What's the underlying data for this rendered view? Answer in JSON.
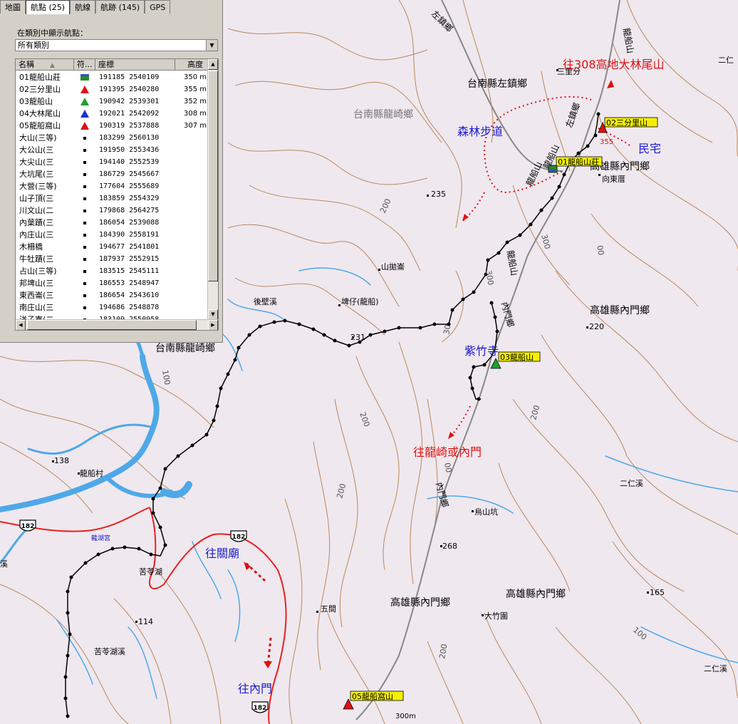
{
  "panel": {
    "tabs": [
      {
        "label": "地圖",
        "active": false
      },
      {
        "label": "航點 (25)",
        "active": true
      },
      {
        "label": "航線",
        "active": false
      },
      {
        "label": "航跡 (145)",
        "active": false
      },
      {
        "label": "GPS",
        "active": false
      }
    ],
    "category_label": "在類別中顯示航點：",
    "category_value": "所有類別",
    "columns": {
      "name": "名稱",
      "symbol": "符...",
      "coords": "座標",
      "altitude": "高度"
    },
    "waypoints": [
      {
        "name": "01龍船山莊",
        "symbol": "house-icon",
        "coords": "191185 2540109",
        "alt": "350 m"
      },
      {
        "name": "02三分里山",
        "symbol": "red-summit-icon",
        "coords": "191395 2540280",
        "alt": "355 m"
      },
      {
        "name": "03龍船山",
        "symbol": "green-summit-icon",
        "coords": "190942 2539301",
        "alt": "352 m"
      },
      {
        "name": "04大林尾山",
        "symbol": "blue-summit-icon",
        "coords": "192021 2542092",
        "alt": "308 m"
      },
      {
        "name": "05龍船窩山",
        "symbol": "red-summit-icon",
        "coords": "190319 2537888",
        "alt": "307 m"
      },
      {
        "name": "大山(三等)",
        "symbol": "dot-icon",
        "coords": "183299 2560130",
        "alt": ""
      },
      {
        "name": "大公山(三",
        "symbol": "dot-icon",
        "coords": "191950 2553436",
        "alt": ""
      },
      {
        "name": "大尖山(三",
        "symbol": "dot-icon",
        "coords": "194140 2552539",
        "alt": ""
      },
      {
        "name": "大坑尾(三",
        "symbol": "dot-icon",
        "coords": "186729 2545667",
        "alt": ""
      },
      {
        "name": "大營(三等)",
        "symbol": "dot-icon",
        "coords": "177604 2555689",
        "alt": ""
      },
      {
        "name": "山子頂(三",
        "symbol": "dot-icon",
        "coords": "183859 2554329",
        "alt": ""
      },
      {
        "name": "川文山(二",
        "symbol": "dot-icon",
        "coords": "179868 2564275",
        "alt": ""
      },
      {
        "name": "內葉蹟(三",
        "symbol": "dot-icon",
        "coords": "186054 2539088",
        "alt": ""
      },
      {
        "name": "內庄山(三",
        "symbol": "dot-icon",
        "coords": "184390 2558191",
        "alt": ""
      },
      {
        "name": "木柵橋",
        "symbol": "dot-icon",
        "coords": "194677 2541801",
        "alt": ""
      },
      {
        "name": "牛牡蹟(三",
        "symbol": "dot-icon",
        "coords": "187937 2552915",
        "alt": ""
      },
      {
        "name": "占山(三等)",
        "symbol": "dot-icon",
        "coords": "183515 2545111",
        "alt": ""
      },
      {
        "name": "邦埤山(三",
        "symbol": "dot-icon",
        "coords": "186553 2548947",
        "alt": ""
      },
      {
        "name": "東西崙(三",
        "symbol": "dot-icon",
        "coords": "186654 2543610",
        "alt": ""
      },
      {
        "name": "南庄山(三",
        "symbol": "dot-icon",
        "coords": "194686 2548878",
        "alt": ""
      },
      {
        "name": "洋子寮(二",
        "symbol": "dot-icon",
        "coords": "183109 2550958",
        "alt": ""
      }
    ]
  },
  "map": {
    "towns": {
      "zuozhen": "台南縣左鎮鄉",
      "longqi_top": "台南縣龍崎鄉",
      "longqi": "台南縣龍崎鄉",
      "neimen_a": "高雄縣內門鄉",
      "neimen_b": "高雄縣內門鄉",
      "neimen_c": "高雄縣內門鄉",
      "neimen_d": "高雄縣內門鄉"
    },
    "places": {
      "sanlifen": "三里分",
      "xiangdongcuo": "向東厝",
      "shanpaolun": "山拋崙",
      "pizai": "埤仔(龍船)",
      "houbixi": "後壁溪",
      "longchuancun": "龍船村",
      "kuchahu": "苦苓湖",
      "kuchahuxi": "苦苓湖溪",
      "wujian": "五間",
      "wushankeng": "烏山坑",
      "dazhuwei": "大竹圍",
      "errenxi_a": "二仁溪",
      "errenxi_b": "二仁溪",
      "errenxi_c": "二仁",
      "xi_left": "溪",
      "hulonggong": "龍湖宮"
    },
    "roads": {
      "zuozhen_road": "左鎮鄉",
      "zuozhen_road2": "左鎮鄉",
      "longchuan_road": "龍船山",
      "longchuan_road2": "龍船山",
      "longchuan_road3": "龍船山",
      "longchuan_road4": "龍船山",
      "neimen_road": "內門鄉",
      "neimen_road2": "內門鄉",
      "route_182": "182"
    },
    "elevations": {
      "e235": "235",
      "e231": "231",
      "e200a": "200",
      "e200b": "200",
      "e200c": "200",
      "e200d": "200",
      "e200e": "200",
      "e300": "300",
      "e300b": "300",
      "e100a": "100",
      "e100b": "100",
      "e138": "138",
      "e114": "114",
      "e220": "220",
      "e268": "268",
      "e165": "165",
      "e355": "355",
      "e300m": "300m",
      "e30": "30",
      "e00": "00"
    },
    "waypoint_labels": {
      "wp01": "01龍船山莊",
      "wp02": "02三分里山",
      "wp03": "03龍船山",
      "wp05": "05龍船窩山"
    },
    "annotations": {
      "to_308": "往308高地大林尾山",
      "forest_trail": "森林步道",
      "residence": "民宅",
      "zizhu_temple": "紫竹寺",
      "to_longqi_neimen": "往龍崎或內門",
      "to_guanmiao": "往關廟",
      "to_neimen": "往內門"
    },
    "colors": {
      "background": "#efe8ef",
      "contour": "#b07840",
      "river": "#4ea8e8",
      "route": "#e8201e",
      "road": "#888888",
      "track": "#000000",
      "annotation_red": "#e01010",
      "annotation_blue": "#1a1ad0"
    }
  }
}
